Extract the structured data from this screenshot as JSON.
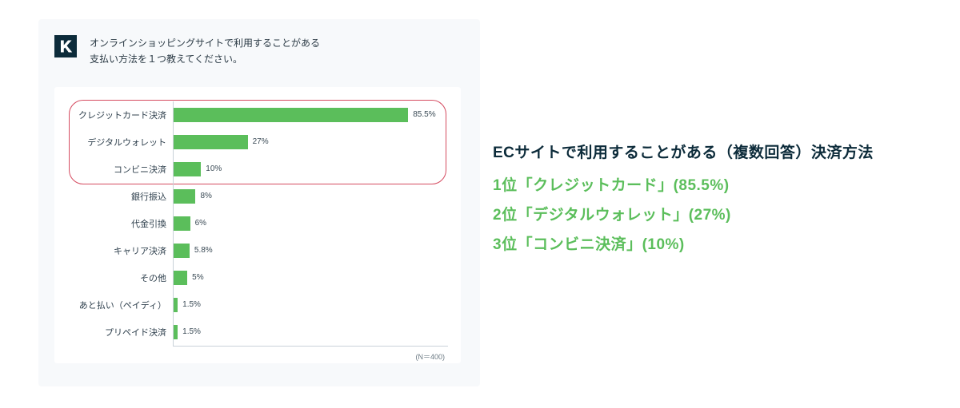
{
  "question_line1": "オンラインショッピングサイトで利用することがある",
  "question_line2": "支払い方法を１つ教えてください。",
  "n_note": "(N＝400)",
  "chart_data": {
    "type": "bar",
    "orientation": "horizontal",
    "categories": [
      "クレジットカード決済",
      "デジタルウォレット",
      "コンビニ決済",
      "銀行振込",
      "代金引換",
      "キャリア決済",
      "その他",
      "あと払い（ペイディ）",
      "プリペイド決済"
    ],
    "values": [
      85.5,
      27,
      10,
      8,
      6,
      5.8,
      5,
      1.5,
      1.5
    ],
    "value_labels": [
      "85.5%",
      "27%",
      "10%",
      "8%",
      "6%",
      "5.8%",
      "5%",
      "1.5%",
      "1.5%"
    ],
    "xlim": [
      0,
      100
    ],
    "highlight_rows": [
      0,
      1,
      2
    ],
    "title": "",
    "xlabel": "",
    "ylabel": ""
  },
  "summary": {
    "title": "ECサイトで利用することがある（複数回答）決済方法",
    "ranks": [
      "1位「クレジットカード」(85.5%)",
      "2位「デジタルウォレット」(27%)",
      "3位「コンビニ決済」(10%)"
    ]
  }
}
